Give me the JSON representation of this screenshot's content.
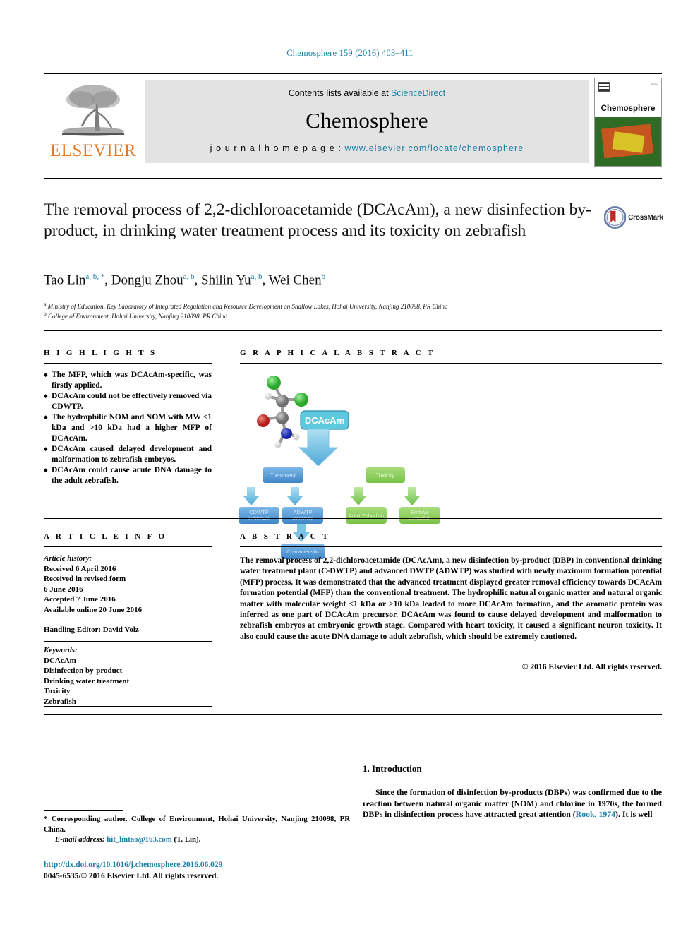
{
  "running_head": "Chemosphere 159 (2016) 403–411",
  "masthead": {
    "contents_prefix": "Contents lists available at ",
    "contents_link": "ScienceDirect",
    "journal_name": "Chemosphere",
    "homepage_prefix": "j o u r n a l   h o m e p a g e :  ",
    "homepage_url": "www.elsevier.com/locate/chemosphere",
    "publisher": "ELSEVIER",
    "cover_title": "Chemosphere"
  },
  "article": {
    "title": "The removal process of 2,2-dichloroacetamide (DCAcAm), a new disinfection by-product, in drinking water treatment process and its toxicity on zebrafish",
    "crossmark_label": "CrossMark",
    "authors": [
      {
        "name": "Tao Lin",
        "sup": "a, b, *"
      },
      {
        "name": "Dongju Zhou",
        "sup": "a, b"
      },
      {
        "name": "Shilin Yu",
        "sup": "a, b"
      },
      {
        "name": "Wei Chen",
        "sup": "b"
      }
    ],
    "affiliations": [
      {
        "mark": "a",
        "text": "Ministry of Education, Key Laboratory of Integrated Regulation and Resource Development on Shallow Lakes, Hohai University, Nanjing 210098, PR China"
      },
      {
        "mark": "b",
        "text": "College of Environment, Hohai University, Nanjing 210098, PR China"
      }
    ]
  },
  "highlights": {
    "heading": "H I G H L I G H T S",
    "items": [
      "The MFP, which was DCAcAm-specific, was firstly applied.",
      "DCAcAm could not be effectively removed via CDWTP.",
      "The hydrophilic NOM and NOM with MW <1 kDa and >10 kDa had a higher MFP of DCAcAm.",
      "DCAcAm caused delayed development and malformation to zebrafish embryos.",
      "DCAcAm could cause acute DNA damage to the adult zebrafish."
    ]
  },
  "graphical_abstract": {
    "heading": "G R A P H I C A L   A B S T R A C T",
    "molecule_label": "DCAcAm",
    "nodes": [
      {
        "id": "treatment",
        "label": "Treatment",
        "color": "#5b9bd5"
      },
      {
        "id": "toxicity",
        "label": "Toxicity",
        "color": "#92d050"
      },
      {
        "id": "cdwtp",
        "label": "CDWTP Removal",
        "color": "#5b9bd5"
      },
      {
        "id": "adwtp",
        "label": "ADWTP Removal",
        "color": "#5b9bd5"
      },
      {
        "id": "adult",
        "label": "Adult Zebrafish",
        "color": "#92d050"
      },
      {
        "id": "embryo",
        "label": "Embryo Zebrafish",
        "color": "#92d050"
      },
      {
        "id": "characteristic",
        "label": "Characteristic",
        "color": "#5b9bd5"
      }
    ],
    "atom_colors": {
      "chlorine": "#3fbf3f",
      "carbon": "#808080",
      "oxygen": "#cc2020",
      "nitrogen": "#2030c0",
      "hydrogen": "#e8e8e8"
    }
  },
  "article_info": {
    "heading": "A R T I C L E   I N F O",
    "history_label": "Article history:",
    "history": [
      "Received 6 April 2016",
      "Received in revised form",
      "6 June 2016",
      "Accepted 7 June 2016",
      "Available online 20 June 2016"
    ],
    "handling_editor": "Handling Editor: David Volz",
    "keywords_label": "Keywords:",
    "keywords": [
      "DCAcAm",
      "Disinfection by-product",
      "Drinking water treatment",
      "Toxicity",
      "Zebrafish"
    ]
  },
  "abstract": {
    "heading": "A B S T R A C T",
    "text": "The removal process of 2,2-dichloroacetamide (DCAcAm), a new disinfection by-product (DBP) in conventional drinking water treatment plant (C-DWTP) and advanced DWTP (ADWTP) was studied with newly maximum formation potential (MFP) process. It was demonstrated that the advanced treatment displayed greater removal efficiency towards DCAcAm formation potential (MFP) than the conventional treatment. The hydrophilic natural organic matter and natural organic matter with molecular weight <1 kDa or >10 kDa leaded to more DCAcAm formation, and the aromatic protein was inferred as one part of DCAcAm precursor. DCAcAm was found to cause delayed development and malformation to zebrafish embryos at embryonic growth stage. Compared with heart toxicity, it caused a significant neuron toxicity. It also could cause the acute DNA damage to adult zebrafish, which should be extremely cautioned.",
    "copyright": "© 2016 Elsevier Ltd. All rights reserved."
  },
  "introduction": {
    "heading": "1. Introduction",
    "paragraph_before_cite": "Since the formation of disinfection by-products (DBPs) was confirmed due to the reaction between natural organic matter (NOM) and chlorine in 1970s, the formed DBPs in disinfection process have attracted great attention (",
    "citation": "Rook, 1974",
    "paragraph_after_cite": "). It is well"
  },
  "footer": {
    "corresponding_note": "* Corresponding author. College of Environment, Hohai University, Nanjing 210098, PR China.",
    "email_label": "E-mail address:",
    "email": "hit_lintao@163.com",
    "email_suffix": "(T. Lin).",
    "doi": "http://dx.doi.org/10.1016/j.chemosphere.2016.06.029",
    "issn_line": "0045-6535/© 2016 Elsevier Ltd. All rights reserved."
  }
}
